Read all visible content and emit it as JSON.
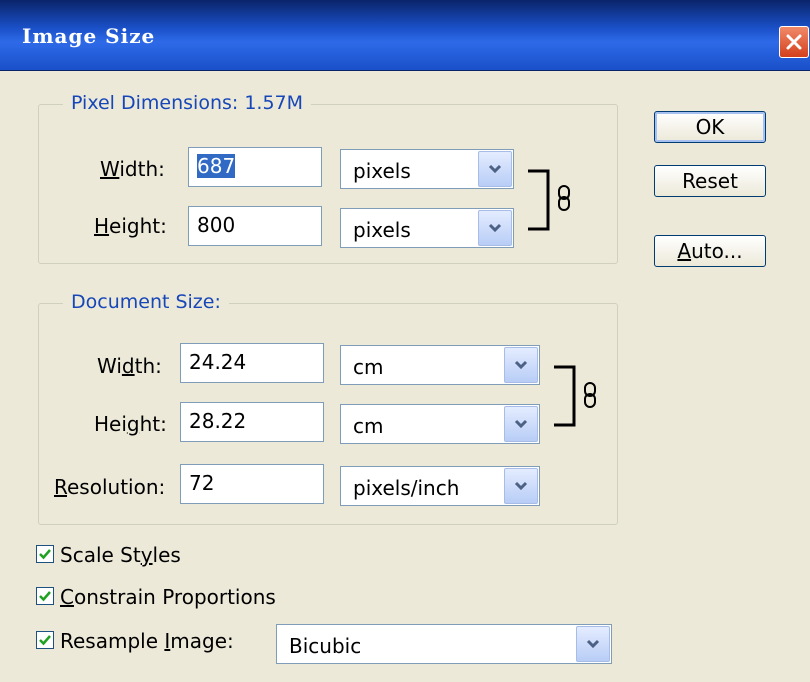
{
  "dialog": {
    "title": "Image Size"
  },
  "pixel_dimensions": {
    "title": "Pixel Dimensions:  1.57M",
    "width_label_u": "W",
    "width_label_rest": "idth:",
    "width_value": "687",
    "width_unit": "pixels",
    "height_label_u": "H",
    "height_label_rest": "eight:",
    "height_value": "800",
    "height_unit": "pixels"
  },
  "document_size": {
    "title": "Document Size:",
    "width_label_a": "Wi",
    "width_label_u": "d",
    "width_label_b": "th:",
    "width_value": "24.24",
    "width_unit": "cm",
    "height_label_a": "Hei",
    "height_label_u": "g",
    "height_label_b": "ht:",
    "height_value": "28.22",
    "height_unit": "cm",
    "resolution_label_u": "R",
    "resolution_label_rest": "esolution:",
    "resolution_value": "72",
    "resolution_unit": "pixels/inch"
  },
  "buttons": {
    "ok": "OK",
    "reset": "Reset",
    "auto_u": "A",
    "auto_rest": "uto..."
  },
  "options": {
    "scale_styles_a": "Scale St",
    "scale_styles_u": "y",
    "scale_styles_b": "les",
    "scale_styles_checked": true,
    "constrain_u": "C",
    "constrain_rest": "onstrain Proportions",
    "constrain_checked": true,
    "resample_a": "Resample ",
    "resample_u": "I",
    "resample_b": "mage:",
    "resample_checked": true,
    "resample_method": "Bicubic"
  },
  "colors": {
    "titlebar": "#1a50c8",
    "group_title": "#1646b8",
    "selection": "#316ac5",
    "dialog_bg": "#ece9d8"
  }
}
